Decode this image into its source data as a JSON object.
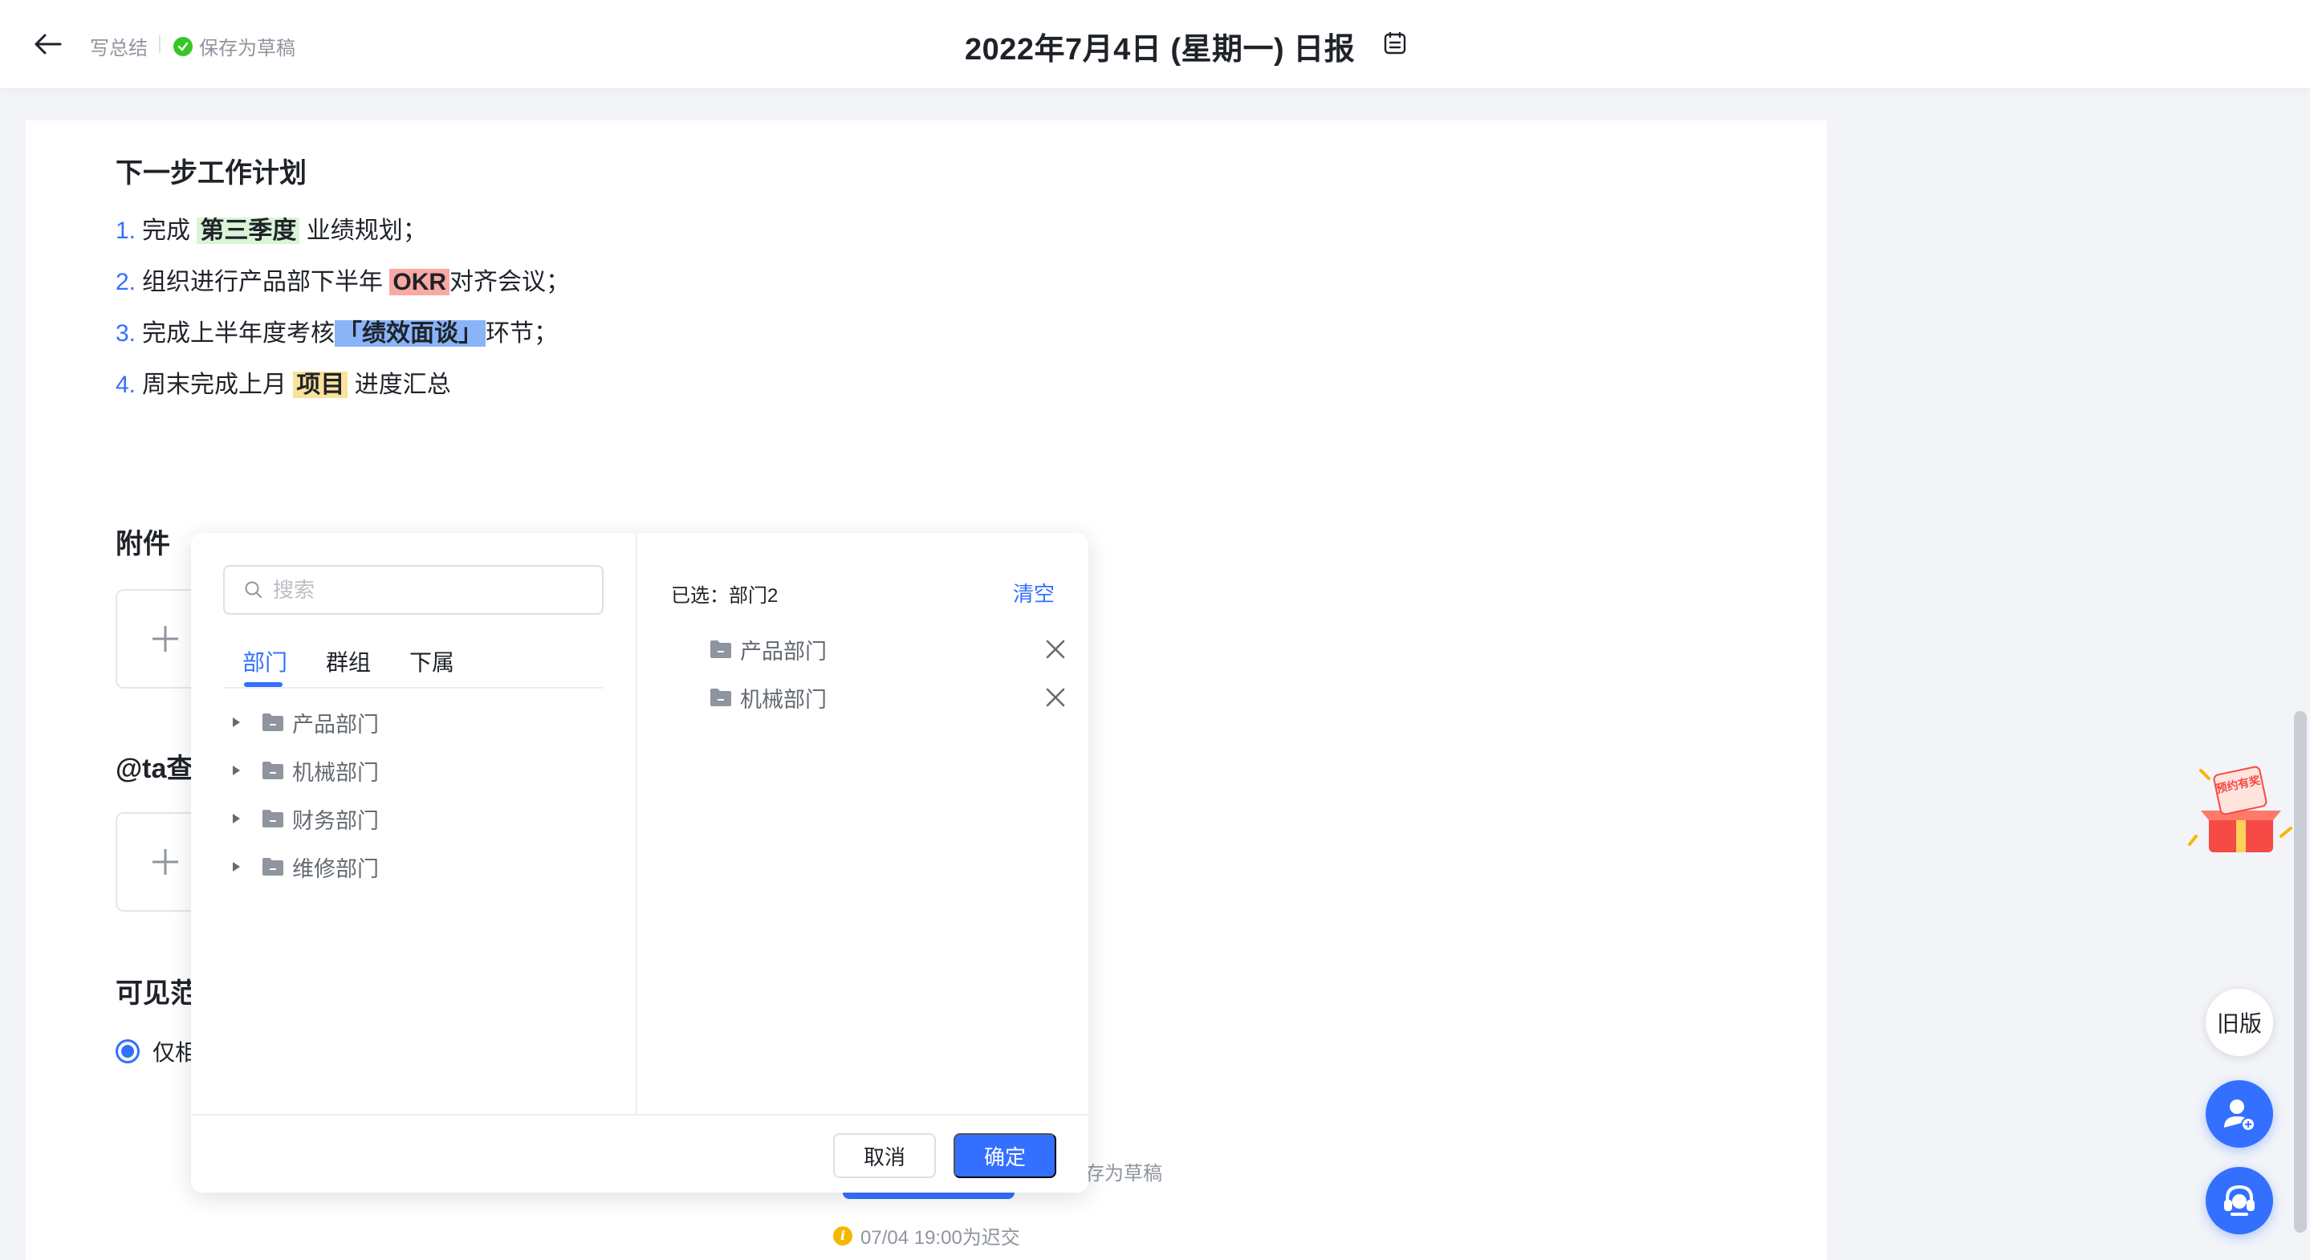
{
  "header": {
    "crumb": "写总结",
    "saved_status": "保存为草稿",
    "title": "2022年7月4日 (星期一) 日报"
  },
  "plan": {
    "title": "下一步工作计划",
    "items": [
      {
        "num": "1.",
        "before": "完成 ",
        "highlight": "第三季度",
        "after": " 业绩规划；",
        "color": "#d9f5d6"
      },
      {
        "num": "2.",
        "before": "组织进行产品部下半年 ",
        "highlight": "OKR",
        "after": "对齐会议；",
        "color": "#f8a9a3"
      },
      {
        "num": "3.",
        "before": "完成上半年度考核",
        "highlight": "「绩效面谈」",
        "after": "环节；",
        "color": "#8ab4f8"
      },
      {
        "num": "4.",
        "before": "周末完成上月 ",
        "highlight": "项目",
        "after": " 进度汇总",
        "color": "#fbe29a"
      }
    ]
  },
  "attachments": {
    "title": "附件"
  },
  "mention": {
    "title": "@ta查看"
  },
  "visibility": {
    "title": "可见范围",
    "option": "仅相关"
  },
  "footer": {
    "draft": "存为草稿",
    "deadline": "07/04 19:00为迟交"
  },
  "popup": {
    "search_placeholder": "搜索",
    "tabs": [
      "部门",
      "群组",
      "下属"
    ],
    "active_tab": "部门",
    "tree": [
      "产品部门",
      "机械部门",
      "财务部门",
      "维修部门"
    ],
    "selected_label": "已选：部门2",
    "clear": "清空",
    "selected": [
      "产品部门",
      "机械部门"
    ],
    "cancel": "取消",
    "confirm": "确定"
  },
  "widgets": {
    "old_version": "旧版",
    "promo_text": "预约有奖"
  },
  "colors": {
    "accent": "#3370ff",
    "success": "#34c724",
    "warning": "#f5b800"
  }
}
